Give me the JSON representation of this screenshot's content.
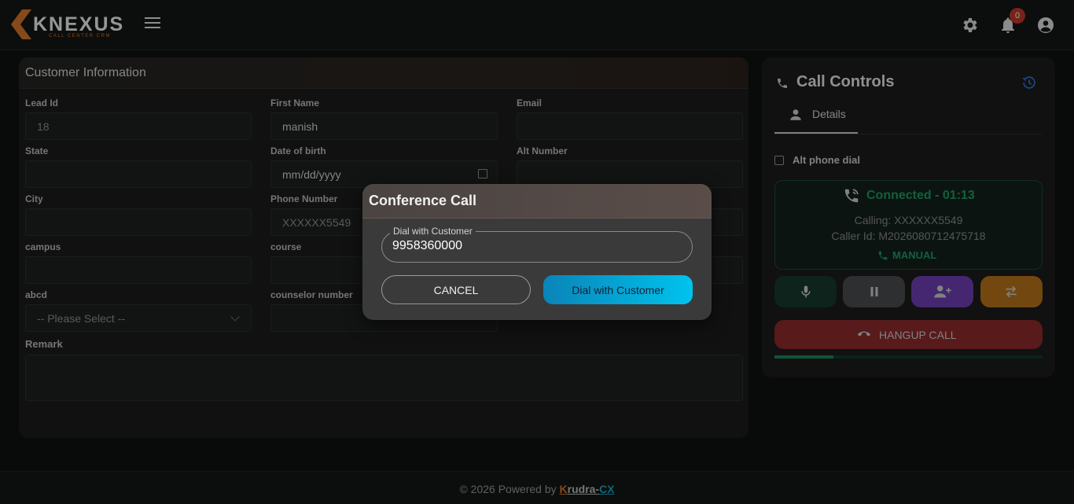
{
  "app": {
    "logo_text": "KNEXUS",
    "logo_subtext": "CALL CENTER CRM",
    "notification_count": "0"
  },
  "customer_info": {
    "title": "Customer Information",
    "fields": {
      "lead_id": {
        "label": "Lead Id",
        "value": "18"
      },
      "first_name": {
        "label": "First Name",
        "value": "manish"
      },
      "email": {
        "label": "Email",
        "value": ""
      },
      "state": {
        "label": "State",
        "value": ""
      },
      "dob": {
        "label": "Date of birth",
        "value": "mm/dd/yyyy"
      },
      "alt_number": {
        "label": "Alt Number",
        "value": ""
      },
      "city": {
        "label": "City",
        "value": ""
      },
      "phone_number": {
        "label": "Phone Number",
        "value": "XXXXXX5549"
      },
      "campus": {
        "label": "campus",
        "value": ""
      },
      "course": {
        "label": "course",
        "value": ""
      },
      "abcd": {
        "label": "abcd",
        "value": "-- Please Select --"
      },
      "counselor_number": {
        "label": "counselor number",
        "value": ""
      },
      "remark": {
        "label": "Remark",
        "value": ""
      }
    }
  },
  "call_controls": {
    "title": "Call Controls",
    "tab_details": "Details",
    "alt_phone_dial": "Alt phone dial",
    "status": "Connected - 01:13",
    "calling": "Calling: XXXXXX5549",
    "caller_id": "Caller Id: M2026080712475718",
    "mode": "MANUAL",
    "hangup": "HANGUP CALL",
    "call_progress": 0.22,
    "colors": {
      "mute": "#16392d",
      "hold": "#4a4d50",
      "add_user": "#6e3fb5",
      "transfer": "#b8741a"
    }
  },
  "modal": {
    "title": "Conference Call",
    "field_label": "Dial with Customer",
    "field_value": "9958360000",
    "cancel": "CANCEL",
    "dial": "Dial with Customer"
  },
  "footer": {
    "prefix": "© 2026 Powered by",
    "brand_k": "K",
    "brand_rest": "rudra-",
    "brand_cx": "CX"
  }
}
